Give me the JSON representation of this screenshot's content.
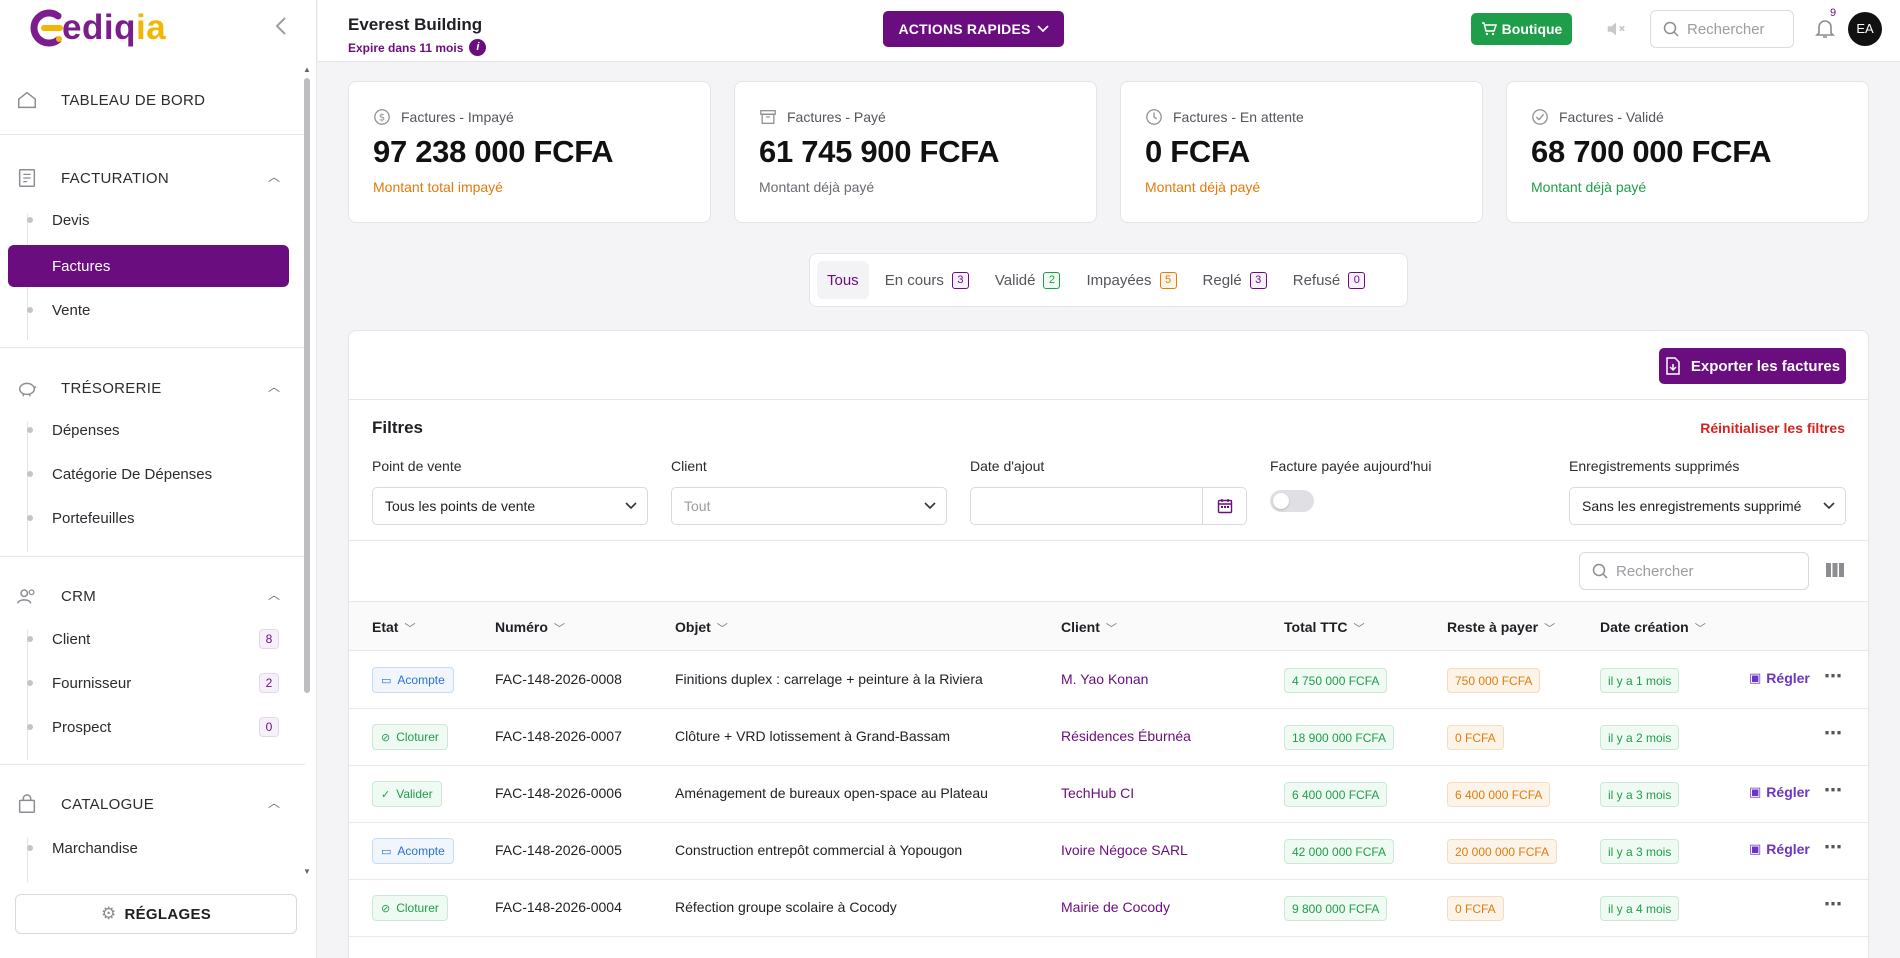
{
  "brand": {
    "logo_main": "edi",
    "logo_q": "q",
    "logo_end": "ia"
  },
  "sidebar": {
    "dashboard": "TABLEAU DE BORD",
    "sections": [
      {
        "label": "FACTURATION",
        "icon": "invoice-icon",
        "items": [
          {
            "label": "Devis"
          },
          {
            "label": "Factures",
            "active": true
          },
          {
            "label": "Vente"
          }
        ]
      },
      {
        "label": "TRÉSORERIE",
        "icon": "piggy-bank-icon",
        "items": [
          {
            "label": "Dépenses"
          },
          {
            "label": "Catégorie De Dépenses"
          },
          {
            "label": "Portefeuilles"
          }
        ]
      },
      {
        "label": "CRM",
        "icon": "users-icon",
        "items": [
          {
            "label": "Client",
            "badge": "8"
          },
          {
            "label": "Fournisseur",
            "badge": "2"
          },
          {
            "label": "Prospect",
            "badge": "0"
          }
        ]
      },
      {
        "label": "CATALOGUE",
        "icon": "shopping-bag-icon",
        "items": [
          {
            "label": "Marchandise"
          }
        ]
      }
    ],
    "settings": "RÉGLAGES"
  },
  "topbar": {
    "building": "Everest Building",
    "expire": "Expire dans 11 mois",
    "quick_actions": "ACTIONS RAPIDES",
    "shop": "Boutique",
    "search_placeholder": "Rechercher",
    "notif_count": "9",
    "avatar": "EA"
  },
  "cards": [
    {
      "title": "Factures - Impayé",
      "value": "97 238 000 FCFA",
      "sub": "Montant total impayé",
      "sub_color": "#e07b0c",
      "icon": "dollar-circle-icon"
    },
    {
      "title": "Factures - Payé",
      "value": "61 745 900 FCFA",
      "sub": "Montant déjà payé",
      "sub_color": "#6b6b72",
      "icon": "archive-icon"
    },
    {
      "title": "Factures - En attente",
      "value": "0 FCFA",
      "sub": "Montant déjà payé",
      "sub_color": "#e07b0c",
      "icon": "clock-icon"
    },
    {
      "title": "Factures - Validé",
      "value": "68 700 000 FCFA",
      "sub": "Montant déjà payé",
      "sub_color": "#1e9e4a",
      "icon": "check-circle-icon"
    }
  ],
  "tabs": [
    {
      "label": "Tous",
      "active": true
    },
    {
      "label": "En cours",
      "count": "3",
      "tone": "purple"
    },
    {
      "label": "Validé",
      "count": "2",
      "tone": "purple"
    },
    {
      "label": "Impayées",
      "count": "5",
      "tone": "orange"
    },
    {
      "label": "Reglé",
      "count": "3",
      "tone": "purple"
    },
    {
      "label": "Refusé",
      "count": "0",
      "tone": "purple"
    }
  ],
  "panel": {
    "export": "Exporter les factures",
    "filters_title": "Filtres",
    "reset": "Réinitialiser les filtres",
    "filters": {
      "point_label": "Point de vente",
      "point_value": "Tous les points de vente",
      "client_label": "Client",
      "client_placeholder": "Tout",
      "date_label": "Date d'ajout",
      "paid_today_label": "Facture payée aujourd'hui",
      "deleted_label": "Enregistrements supprimés",
      "deleted_value": "Sans les enregistrements supprimé"
    },
    "search_placeholder": "Rechercher"
  },
  "table": {
    "columns": [
      "Etat",
      "Numéro",
      "Objet",
      "Client",
      "Total TTC",
      "Reste à payer",
      "Date création"
    ],
    "regler_label": "Régler",
    "rows": [
      {
        "etat": "Acompte",
        "etat_type": "acompte",
        "numero": "FAC-148-2026-0008",
        "objet": "Finitions duplex : carrelage + peinture à la Riviera",
        "client": "M. Yao Konan",
        "total": "4 750 000 FCFA",
        "reste": "750 000 FCFA",
        "date": "il y a 1 mois",
        "regler": true
      },
      {
        "etat": "Cloturer",
        "etat_type": "cloturer",
        "numero": "FAC-148-2026-0007",
        "objet": "Clôture + VRD lotissement à Grand-Bassam",
        "client": "Résidences Éburnéa",
        "total": "18 900 000 FCFA",
        "reste": "0 FCFA",
        "date": "il y a 2 mois",
        "regler": false
      },
      {
        "etat": "Valider",
        "etat_type": "valider",
        "numero": "FAC-148-2026-0006",
        "objet": "Aménagement de bureaux open-space au Plateau",
        "client": "TechHub CI",
        "total": "6 400 000 FCFA",
        "reste": "6 400 000 FCFA",
        "date": "il y a 3 mois",
        "regler": true
      },
      {
        "etat": "Acompte",
        "etat_type": "acompte",
        "numero": "FAC-148-2026-0005",
        "objet": "Construction entrepôt commercial à Yopougon",
        "client": "Ivoire Négoce SARL",
        "total": "42 000 000 FCFA",
        "reste": "20 000 000 FCFA",
        "date": "il y a 3 mois",
        "regler": true
      },
      {
        "etat": "Cloturer",
        "etat_type": "cloturer",
        "numero": "FAC-148-2026-0004",
        "objet": "Réfection groupe scolaire à Cocody",
        "client": "Mairie de Cocody",
        "total": "9 800 000 FCFA",
        "reste": "0 FCFA",
        "date": "il y a 4 mois",
        "regler": false
      }
    ]
  }
}
